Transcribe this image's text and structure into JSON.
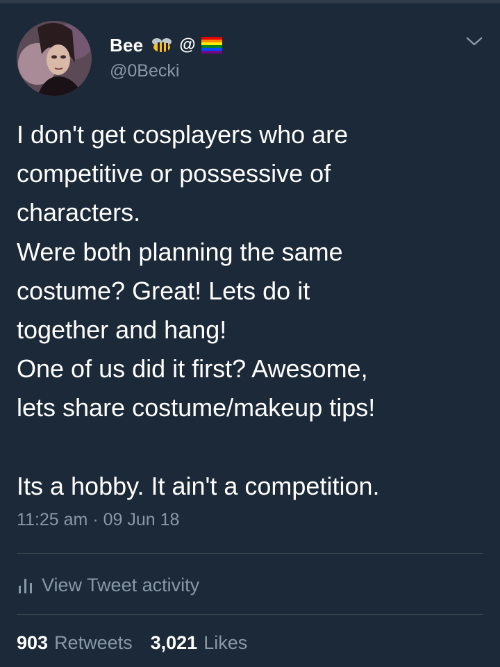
{
  "user": {
    "display_name": "Bee",
    "name_icons": [
      "bee-emoji-icon",
      "rainbow-flag-icon"
    ],
    "at_symbol": "@",
    "handle": "@0Becki"
  },
  "tweet": {
    "text": "I don't get cosplayers who are\ncompetitive or possessive of\ncharacters.\nWere both planning the same\ncostume? Great! Lets do it\ntogether and hang!\nOne of us did it first? Awesome,\nlets share costume/makeup tips!\n\nIts a hobby. It ain't a competition.",
    "time": "11:25 am",
    "separator": "·",
    "date": "09 Jun 18"
  },
  "activity": {
    "icon": "bar-chart-icon",
    "label": "View Tweet activity"
  },
  "stats": {
    "retweets_count": "903",
    "retweets_label": "Retweets",
    "likes_count": "3,021",
    "likes_label": "Likes"
  },
  "colors": {
    "background": "#1c2938",
    "text": "#ffffff",
    "secondary_text": "#8899a6",
    "divider": "#38444d"
  }
}
